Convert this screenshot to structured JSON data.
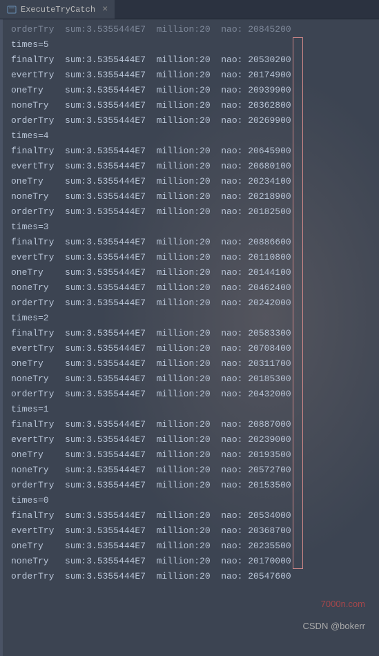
{
  "tab": {
    "label": "ExecuteTryCatch",
    "close": "×"
  },
  "topPartialLine": "orderTry  sum:3.5355444E7  million:20  nao: 20845200",
  "blocks": [
    {
      "times": 5,
      "rows": [
        {
          "name": "finalTry",
          "sum": "3.5355444E7",
          "million": 20,
          "nao": 20530200
        },
        {
          "name": "evertTry",
          "sum": "3.5355444E7",
          "million": 20,
          "nao": 20174900
        },
        {
          "name": "oneTry",
          "sum": "3.5355444E7",
          "million": 20,
          "nao": 20939900
        },
        {
          "name": "noneTry",
          "sum": "3.5355444E7",
          "million": 20,
          "nao": 20362800
        },
        {
          "name": "orderTry",
          "sum": "3.5355444E7",
          "million": 20,
          "nao": 20269900
        }
      ]
    },
    {
      "times": 4,
      "rows": [
        {
          "name": "finalTry",
          "sum": "3.5355444E7",
          "million": 20,
          "nao": 20645900
        },
        {
          "name": "evertTry",
          "sum": "3.5355444E7",
          "million": 20,
          "nao": 20680100
        },
        {
          "name": "oneTry",
          "sum": "3.5355444E7",
          "million": 20,
          "nao": 20234100
        },
        {
          "name": "noneTry",
          "sum": "3.5355444E7",
          "million": 20,
          "nao": 20218900
        },
        {
          "name": "orderTry",
          "sum": "3.5355444E7",
          "million": 20,
          "nao": 20182500
        }
      ]
    },
    {
      "times": 3,
      "rows": [
        {
          "name": "finalTry",
          "sum": "3.5355444E7",
          "million": 20,
          "nao": 20886600
        },
        {
          "name": "evertTry",
          "sum": "3.5355444E7",
          "million": 20,
          "nao": 20110800
        },
        {
          "name": "oneTry",
          "sum": "3.5355444E7",
          "million": 20,
          "nao": 20144100
        },
        {
          "name": "noneTry",
          "sum": "3.5355444E7",
          "million": 20,
          "nao": 20462400
        },
        {
          "name": "orderTry",
          "sum": "3.5355444E7",
          "million": 20,
          "nao": 20242000
        }
      ]
    },
    {
      "times": 2,
      "rows": [
        {
          "name": "finalTry",
          "sum": "3.5355444E7",
          "million": 20,
          "nao": 20583300
        },
        {
          "name": "evertTry",
          "sum": "3.5355444E7",
          "million": 20,
          "nao": 20708400
        },
        {
          "name": "oneTry",
          "sum": "3.5355444E7",
          "million": 20,
          "nao": 20311700
        },
        {
          "name": "noneTry",
          "sum": "3.5355444E7",
          "million": 20,
          "nao": 20185300
        },
        {
          "name": "orderTry",
          "sum": "3.5355444E7",
          "million": 20,
          "nao": 20432000
        }
      ]
    },
    {
      "times": 1,
      "rows": [
        {
          "name": "finalTry",
          "sum": "3.5355444E7",
          "million": 20,
          "nao": 20887000
        },
        {
          "name": "evertTry",
          "sum": "3.5355444E7",
          "million": 20,
          "nao": 20239000
        },
        {
          "name": "oneTry",
          "sum": "3.5355444E7",
          "million": 20,
          "nao": 20193500
        },
        {
          "name": "noneTry",
          "sum": "3.5355444E7",
          "million": 20,
          "nao": 20572700
        },
        {
          "name": "orderTry",
          "sum": "3.5355444E7",
          "million": 20,
          "nao": 20153500
        }
      ]
    },
    {
      "times": 0,
      "rows": [
        {
          "name": "finalTry",
          "sum": "3.5355444E7",
          "million": 20,
          "nao": 20534000
        },
        {
          "name": "evertTry",
          "sum": "3.5355444E7",
          "million": 20,
          "nao": 20368700
        },
        {
          "name": "oneTry",
          "sum": "3.5355444E7",
          "million": 20,
          "nao": 20235500
        },
        {
          "name": "noneTry",
          "sum": "3.5355444E7",
          "million": 20,
          "nao": 20170000
        },
        {
          "name": "orderTry",
          "sum": "3.5355444E7",
          "million": 20,
          "nao": 20547600
        }
      ]
    }
  ],
  "highlightBox": {
    "heightLines": 35
  },
  "watermark": "7000n.com",
  "csdn": "CSDN @bokerr"
}
